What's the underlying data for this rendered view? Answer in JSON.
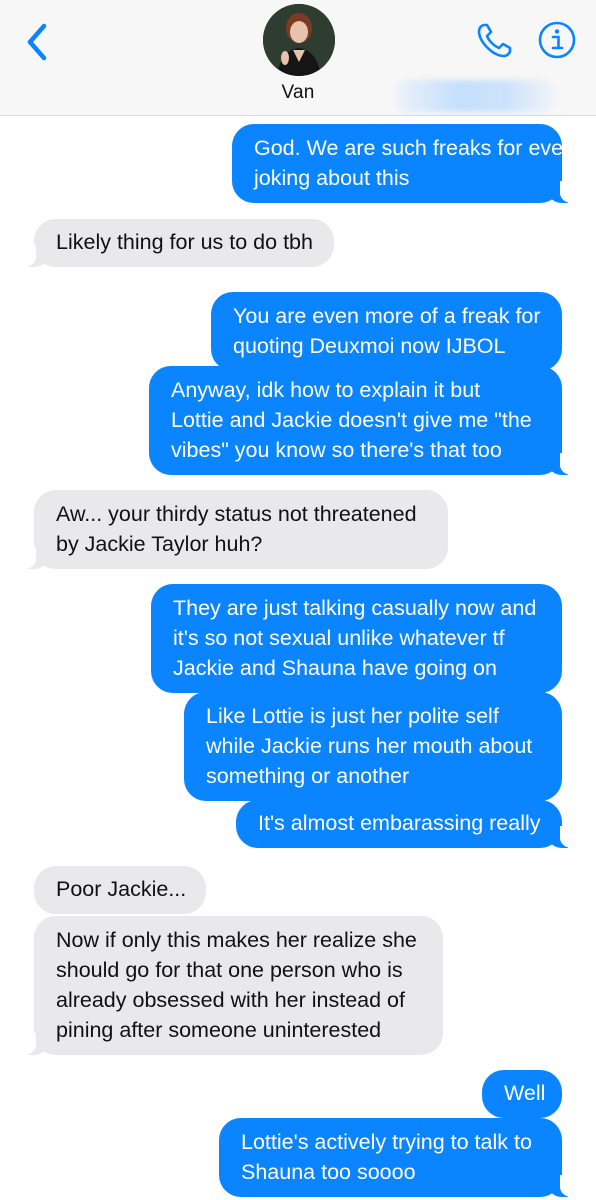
{
  "header": {
    "contact_name": "Van",
    "back_icon": "chevron-left-icon",
    "phone_icon": "phone-icon",
    "info_icon": "info-icon",
    "accent_color": "#0a84ff"
  },
  "messages": [
    {
      "direction": "sent",
      "lines": [
        "God. We are such freaks for even",
        "joking about this"
      ]
    },
    {
      "direction": "received",
      "lines": [
        "Likely thing for us to do tbh"
      ]
    },
    {
      "direction": "sent",
      "lines": [
        "You are even more of a freak for",
        "quoting Deuxmoi now IJBOL"
      ]
    },
    {
      "direction": "sent",
      "lines": [
        "Anyway, idk how to explain it but",
        "Lottie and Jackie doesn't give me \"the",
        "vibes\" you know so there's that too"
      ]
    },
    {
      "direction": "received",
      "lines": [
        "Aw... your thirdy status not threatened",
        "by Jackie Taylor huh?"
      ]
    },
    {
      "direction": "sent",
      "lines": [
        "They are just talking casually now and",
        "it's so not sexual unlike whatever tf",
        "Jackie and Shauna have going on"
      ]
    },
    {
      "direction": "sent",
      "lines": [
        "Like Lottie is just her polite self",
        "while Jackie runs her mouth about",
        "something or another"
      ]
    },
    {
      "direction": "sent",
      "lines": [
        "It's almost embarassing really"
      ]
    },
    {
      "direction": "received",
      "lines": [
        "Poor Jackie..."
      ]
    },
    {
      "direction": "received",
      "lines": [
        "Now if only this makes her realize she",
        "should go for that one person who is",
        "already obsessed with her instead of",
        "pining after someone uninterested"
      ]
    },
    {
      "direction": "sent",
      "lines": [
        "Well"
      ]
    },
    {
      "direction": "sent",
      "lines": [
        "Lottie's actively trying to talk to",
        "Shauna too soooo"
      ]
    }
  ]
}
